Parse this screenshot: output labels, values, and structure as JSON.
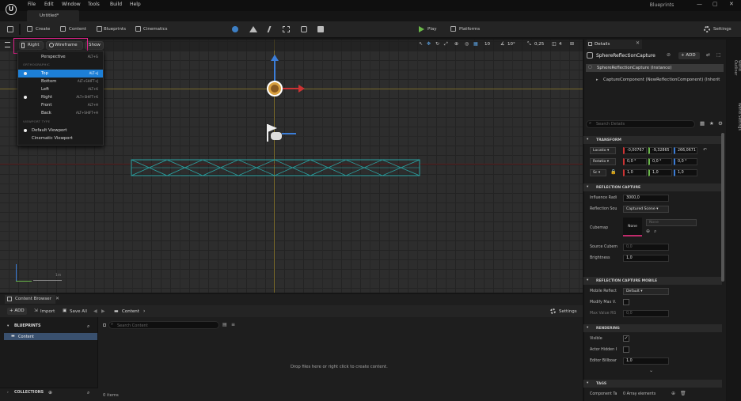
{
  "menu": {
    "file": "File",
    "edit": "Edit",
    "window": "Window",
    "tools": "Tools",
    "build": "Build",
    "help": "Help"
  },
  "doc_tab": "Untitled",
  "project_name": "Blueprints",
  "window_controls": {
    "minimize": "—",
    "restore": "▢",
    "close": "✕"
  },
  "toolbar": {
    "create": "Create",
    "content": "Content",
    "blueprints": "Blueprints",
    "cinematics": "Cinematics",
    "play": "Play",
    "platforms": "Platforms",
    "settings": "Settings"
  },
  "viewport": {
    "view_mode": "Right",
    "render_mode": "Wireframe",
    "show": "Show",
    "grid_snap": "10",
    "rot_snap": "10°",
    "scale_snap": "0,25",
    "camera_speed": "4",
    "scale_label": "1m"
  },
  "view_menu": {
    "first": {
      "label": "Perspective",
      "shortcut": "ALT+G"
    },
    "ortho_header": "ORTHOGRAPHIC",
    "ortho": [
      {
        "label": "Top",
        "shortcut": "ALT+J"
      },
      {
        "label": "Bottom",
        "shortcut": "ALT+SHIFT+J"
      },
      {
        "label": "Left",
        "shortcut": "ALT+K"
      },
      {
        "label": "Right",
        "shortcut": "ALT+SHIFT+K"
      },
      {
        "label": "Front",
        "shortcut": "ALT+H"
      },
      {
        "label": "Back",
        "shortcut": "ALT+SHIFT+H"
      }
    ],
    "vptype_header": "VIEWPORT TYPE",
    "vptype": [
      {
        "label": "Default Viewport"
      },
      {
        "label": "Cinematic Viewport"
      }
    ]
  },
  "content_browser": {
    "tab": "Content Browser",
    "add": "ADD",
    "import": "Import",
    "save_all": "Save All",
    "path": "Content",
    "settings": "Settings",
    "tree_header": "BLUEPRINTS",
    "tree_item": "Content",
    "search_placeholder": "Search Content",
    "empty_msg": "Drop files here or right click to create content.",
    "collections": "COLLECTIONS",
    "items_count": "0 items"
  },
  "details": {
    "tab": "Details",
    "actor_name": "SphereReflectionCapture",
    "add": "ADD",
    "instance": "SphereReflectionCapture (Instance)",
    "component": "CaptureComponent (NewReflectionComponent) (Inherit",
    "search_placeholder": "Search Details",
    "sec_transform": "TRANSFORM",
    "loc_label": "Locatio",
    "loc": [
      "-0,00767",
      "-9,32865",
      "266,0671"
    ],
    "rot_label": "Rotatio",
    "rot": [
      "0,0 °",
      "0,0 °",
      "0,0 °"
    ],
    "scale_label": "Sc",
    "scale": [
      "1,0",
      "1,0",
      "1,0"
    ],
    "sec_capture": "REFLECTION CAPTURE",
    "influence_label": "Influence Radi",
    "influence": "3000,0",
    "source_label": "Reflection Sou",
    "source": "Captured Scene",
    "cubemap_label": "Cubemap",
    "cubemap_thumb": "None",
    "cubemap_value": "None",
    "source_angle_label": "Source Cubem",
    "source_angle": "0,0",
    "brightness_label": "Brightness",
    "brightness": "1,0",
    "sec_mobile": "REFLECTION CAPTURE MOBILE",
    "mobile_label": "Mobile Reflect",
    "mobile": "Default",
    "modify_label": "Modify Max V.",
    "maxval_label": "Max Value RG",
    "maxval": "0,0",
    "sec_render": "RENDERING",
    "visible_label": "Visible",
    "hidden_label": "Actor Hidden I",
    "billboard_label": "Editor Billboar",
    "billboard": "1,0",
    "sec_tags": "TAGS",
    "comp_tags_label": "Component Ta",
    "comp_tags": "0 Array elements"
  },
  "side_tabs": {
    "outliner": "World Outliner",
    "settings": "World Settings"
  }
}
